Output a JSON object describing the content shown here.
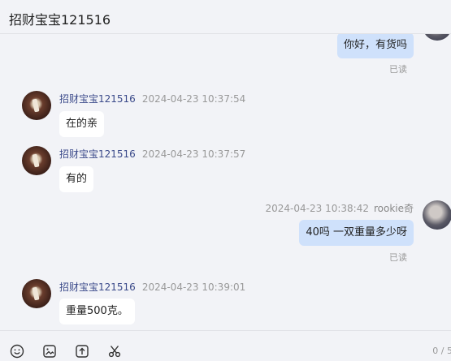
{
  "header": {
    "title": "招财宝宝121516"
  },
  "messages": [
    {
      "side": "right",
      "text": "你好，有货吗",
      "status": "已读"
    },
    {
      "side": "left",
      "name": "招财宝宝121516",
      "time": "2024-04-23 10:37:54",
      "text": "在的亲"
    },
    {
      "side": "left",
      "name": "招财宝宝121516",
      "time": "2024-04-23 10:37:57",
      "text": "有的"
    },
    {
      "side": "right",
      "name": "rookie奇",
      "time": "2024-04-23 10:38:42",
      "text": "40吗  一双重量多少呀",
      "status": "已读"
    },
    {
      "side": "left",
      "name": "招财宝宝121516",
      "time": "2024-04-23 10:39:01",
      "text": "重量500克。"
    }
  ],
  "toolbar": {
    "icons": [
      "emoji-icon",
      "image-icon",
      "upload-icon",
      "scissors-icon"
    ],
    "counter": "0 / 5"
  }
}
